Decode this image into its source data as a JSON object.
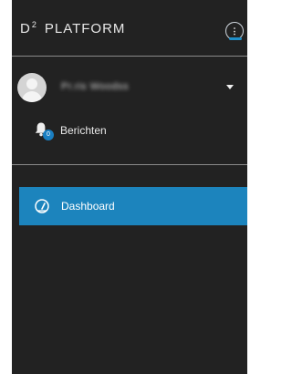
{
  "brand": {
    "logo_letter": "D",
    "logo_superscript": "2",
    "name": "PLATFORM"
  },
  "header": {
    "more_button_label": "⋮"
  },
  "user": {
    "name": "Pr.ris Woodss"
  },
  "messages": {
    "label": "Berichten",
    "count": "0"
  },
  "nav": {
    "items": [
      {
        "label": "Dashboard",
        "icon": "dashboard-gauge-icon",
        "active": true
      }
    ]
  },
  "colors": {
    "sidebar_bg": "#222222",
    "accent": "#1c84bd",
    "badge": "#1a7fc2"
  }
}
